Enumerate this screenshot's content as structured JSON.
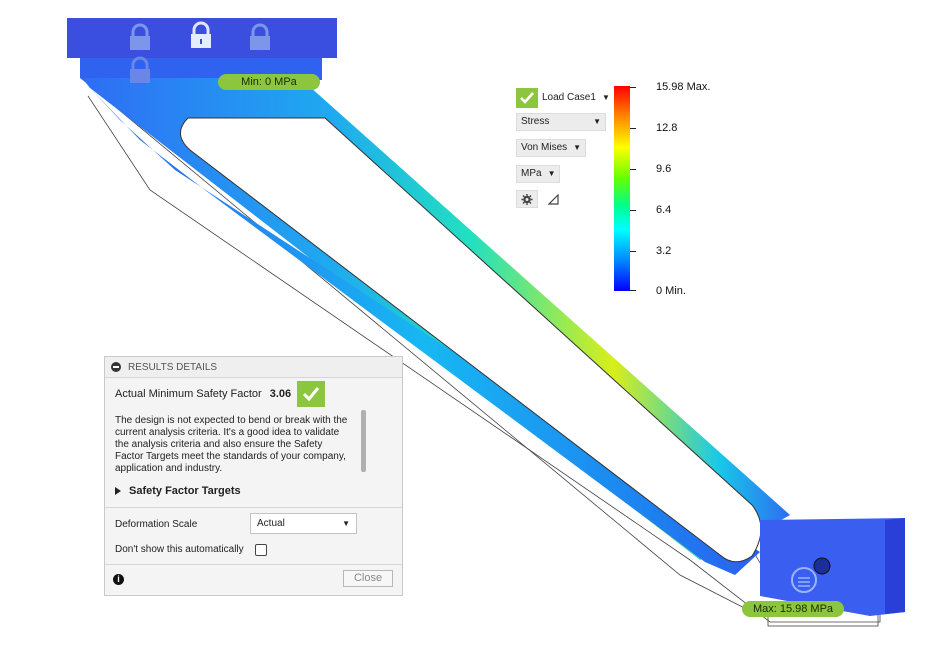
{
  "viewport": {
    "min_label": "Min: 0 MPa",
    "max_label": "Max: 15.98 MPa"
  },
  "legend": {
    "load_case": "Load Case1",
    "result_type": "Stress",
    "stress_component": "Von Mises",
    "units": "MPa",
    "scale_labels": [
      "15.98 Max.",
      "12.8",
      "9.6",
      "6.4",
      "3.2",
      "0 Min."
    ],
    "icons": [
      "check-icon",
      "gear-icon",
      "triangle-icon"
    ]
  },
  "results_details": {
    "title": "RESULTS DETAILS",
    "safety_factor_label": "Actual Minimum Safety Factor",
    "safety_factor_value": "3.06",
    "description": "The design is not expected to bend or break with the current analysis criteria. It's a good idea to validate the analysis criteria and also ensure the Safety Factor Targets meet the standards of your company, application and industry.",
    "targets_label": "Safety Factor Targets",
    "deformation_label": "Deformation Scale",
    "deformation_value": "Actual",
    "dont_show_label": "Don't show this automatically",
    "dont_show_checked": false,
    "close_label": "Close"
  },
  "colors": {
    "accent_green": "#8cc63f",
    "max_stress": "#ff0000",
    "min_stress": "#0000ff"
  }
}
